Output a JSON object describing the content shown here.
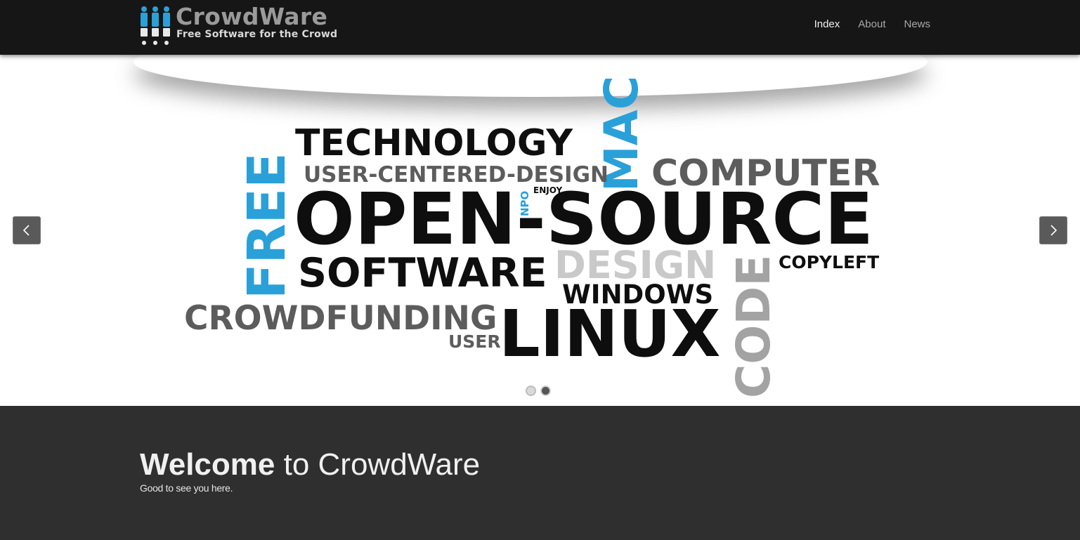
{
  "header": {
    "logo_title": "CrowdWare",
    "logo_subtitle": "Free Software for the Crowd",
    "nav": [
      {
        "label": "Index",
        "active": true
      },
      {
        "label": "About",
        "active": false
      },
      {
        "label": "News",
        "active": false
      }
    ]
  },
  "carousel": {
    "words": {
      "technology": "TECHNOLOGY",
      "mac": "MAC",
      "user_centered": "USER-CENTERED-DESIGN",
      "computer": "COMPUTER",
      "free": "FREE",
      "npo": "NPO",
      "enjoy": "ENJOY",
      "open_source": "OPEN-SOURCE",
      "design": "DESIGN",
      "software": "SOFTWARE",
      "code": "CODE",
      "copyleft": "COPYLEFT",
      "windows": "WINDOWS",
      "crowdfunding": "CROWDFUNDING",
      "linux": "LINUX",
      "user": "USER"
    },
    "slide_count": 2,
    "active_slide": 2,
    "colors": {
      "blue": "#2aa0d9",
      "black": "#0e0e0e",
      "dark_gray": "#5c5c5c",
      "light_gray": "#c9c9c9"
    }
  },
  "welcome": {
    "title_bold": "Welcome",
    "title_rest": " to CrowdWare",
    "subtitle": "Good to see you here."
  },
  "icons": [
    "logo-people-icon",
    "chevron-left-icon",
    "chevron-right-icon"
  ]
}
